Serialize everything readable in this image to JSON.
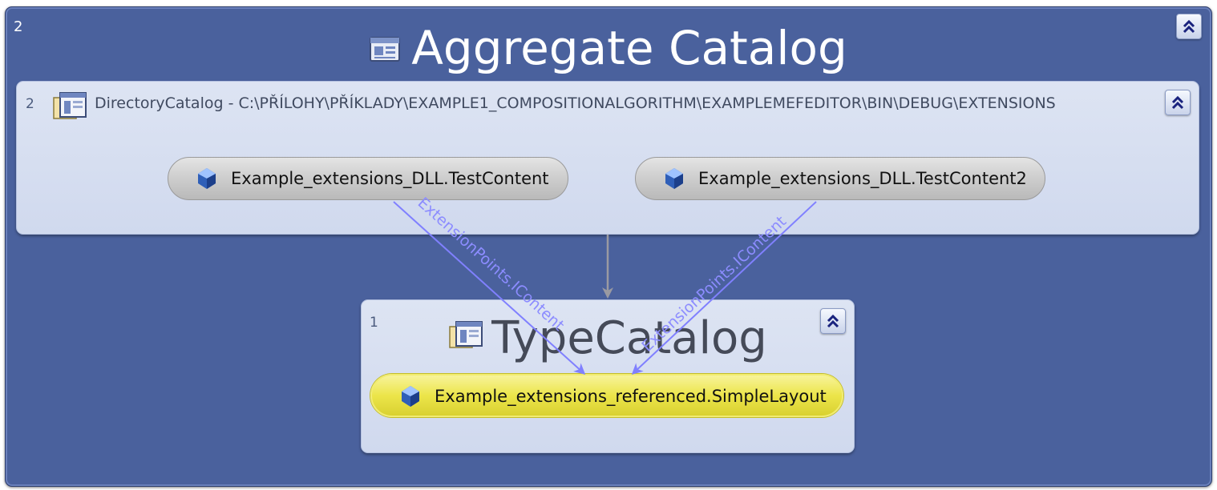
{
  "aggregate_catalog": {
    "count": "2",
    "title": "Aggregate Catalog"
  },
  "directory_catalog": {
    "count": "2",
    "label": "DirectoryCatalog - C:\\PŘÍLOHY\\PŘÍKLADY\\EXAMPLE1_COMPOSITIONALGORITHM\\EXAMPLEMEFEDITOR\\BIN\\DEBUG\\EXTENSIONS",
    "parts": [
      "Example_extensions_DLL.TestContent",
      "Example_extensions_DLL.TestContent2"
    ]
  },
  "type_catalog": {
    "count": "1",
    "title": "TypeCatalog",
    "parts": [
      "Example_extensions_referenced.SimpleLayout"
    ]
  },
  "edges": [
    {
      "label": "ExtensionPoints.IContent",
      "color": "#8080ff"
    },
    {
      "label": "ExtensionPoints.IContent",
      "color": "#8080ff"
    }
  ],
  "colors": {
    "aggregate_bg": "#4a619d",
    "catalog_bg": "#d6def1",
    "part_gray": "#c9c9c9",
    "part_highlight": "#ebe44a",
    "edge": "#8080ff",
    "connector": "#9a9aa2"
  },
  "icons": [
    "catalog-icon",
    "directory-catalog-icon",
    "type-catalog-icon",
    "part-gem-icon",
    "collapse-chevron-icon"
  ]
}
